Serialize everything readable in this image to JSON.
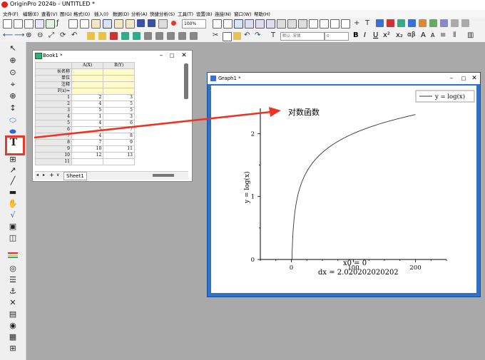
{
  "app": {
    "title": "OriginPro 2024b - UNTITLED *"
  },
  "menu": [
    "文件(F)",
    "编辑(E)",
    "查看(V)",
    "图(G)",
    "格式(O)",
    "插入(I)",
    "数据(D)",
    "分析(A)",
    "快捷分析(S)",
    "工具(T)",
    "设置(B)",
    "连接(N)",
    "窗口(W)",
    "帮助(H)"
  ],
  "toolbar": {
    "zoom": "100%",
    "font_name": "默认: 宋体",
    "font_size": "0",
    "bold": "B",
    "italic": "I",
    "underline": "U",
    "superscript": "x²",
    "subscript": "x₂",
    "greek": "αβ",
    "font_larger": "A",
    "font_smaller": "A"
  },
  "left_tools": {
    "text_tool": "T"
  },
  "book": {
    "title": "Book1 *",
    "columns": [
      "A(X)",
      "B(Y)"
    ],
    "meta_rows": [
      "长名称",
      "单位",
      "注释",
      "F(x)="
    ],
    "rows": [
      [
        "1",
        "2",
        "3"
      ],
      [
        "2",
        "4",
        "5"
      ],
      [
        "3",
        "5",
        "5"
      ],
      [
        "4",
        "1",
        "3"
      ],
      [
        "5",
        "4",
        "6"
      ],
      [
        "6",
        "5",
        "7"
      ],
      [
        "7",
        "4",
        "8"
      ],
      [
        "8",
        "7",
        "9"
      ],
      [
        "9",
        "10",
        "11"
      ],
      [
        "10",
        "12",
        "13"
      ],
      [
        "11",
        "",
        ""
      ]
    ],
    "sheet_tab": "Sheet1"
  },
  "graph": {
    "title": "Graph1 *",
    "layer": "1",
    "annotation": "对数函数",
    "dx_label": "dx = 2.020202020202",
    "x0_label": "x0 = 0"
  },
  "chart_data": {
    "type": "line",
    "series": [
      {
        "name": "y = log(x)",
        "function": "log10(x)",
        "x_range": [
          1,
          200
        ]
      }
    ],
    "xlabel": "x0 = 0",
    "ylabel": "y = log(x)",
    "x_ticks": [
      "0",
      "100",
      "200"
    ],
    "y_ticks": [
      "0",
      "1",
      "2"
    ],
    "xlim": [
      -50,
      250
    ],
    "ylim": [
      0,
      2.4
    ],
    "legend": "top-right",
    "grid": false,
    "colors": {
      "line": "#333333",
      "arrow": "#ee3322",
      "highlight": "#e8392b"
    }
  }
}
